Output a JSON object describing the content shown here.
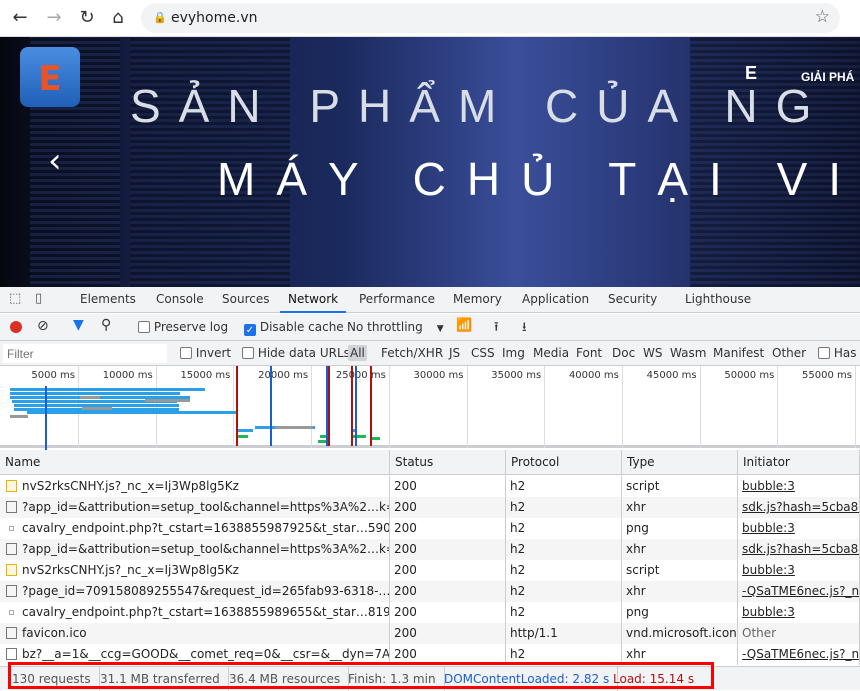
{
  "browser": {
    "url": "evyhome.vn",
    "icons": [
      "back-icon",
      "forward-icon",
      "reload-icon",
      "home-icon",
      "lock-icon",
      "star-icon"
    ]
  },
  "hero": {
    "logo_letter": "E",
    "headline1": "SẢN PHẨM CỦA NG",
    "headline2": "MÁY CHỦ TẠI VIỆ",
    "nav_text": "GIẢI PHÁ",
    "nav_logo": "E"
  },
  "devtools": {
    "tabs": [
      "Elements",
      "Console",
      "Sources",
      "Network",
      "Performance",
      "Memory",
      "Application",
      "Security",
      "Lighthouse"
    ],
    "active_tab": "Network",
    "toolbar": {
      "preserve_log": "Preserve log",
      "preserve_log_checked": false,
      "disable_cache": "Disable cache",
      "disable_cache_checked": true,
      "throttling": "No throttling"
    },
    "filter": {
      "placeholder": "Filter",
      "invert": "Invert",
      "hide_data_urls": "Hide data URLs",
      "types": [
        "All",
        "Fetch/XHR",
        "JS",
        "CSS",
        "Img",
        "Media",
        "Font",
        "Doc",
        "WS",
        "Wasm",
        "Manifest",
        "Other"
      ],
      "active_type": "All",
      "has_blocked": "Has b"
    },
    "timeline": {
      "ticks": [
        "5000 ms",
        "10000 ms",
        "15000 ms",
        "20000 ms",
        "25000 ms",
        "30000 ms",
        "35000 ms",
        "40000 ms",
        "45000 ms",
        "50000 ms",
        "55000 ms"
      ]
    },
    "columns": [
      "Name",
      "Status",
      "Protocol",
      "Type",
      "Initiator"
    ],
    "rows": [
      {
        "icon": "script",
        "name": "nvS2rksCNHY.js?_nc_x=Ij3Wp8lg5Kz",
        "status": "200",
        "protocol": "h2",
        "type": "script",
        "initiator": "bubble:3",
        "link": true
      },
      {
        "icon": "doc",
        "name": "?app_id=&attribution=setup_tool&channel=https%3A%2…k=jo…",
        "status": "200",
        "protocol": "h2",
        "type": "xhr",
        "initiator": "sdk.js?hash=5cba825.",
        "link": true
      },
      {
        "icon": "img",
        "name": "cavalry_endpoint.php?t_cstart=1638855987925&t_star…590&t…",
        "status": "200",
        "protocol": "h2",
        "type": "png",
        "initiator": "bubble:3",
        "link": true
      },
      {
        "icon": "doc",
        "name": "?app_id=&attribution=setup_tool&channel=https%3A%2…k=jo…",
        "status": "200",
        "protocol": "h2",
        "type": "xhr",
        "initiator": "sdk.js?hash=5cba825.",
        "link": true
      },
      {
        "icon": "script",
        "name": "nvS2rksCNHY.js?_nc_x=Ij3Wp8lg5Kz",
        "status": "200",
        "protocol": "h2",
        "type": "script",
        "initiator": "bubble:3",
        "link": true
      },
      {
        "icon": "doc",
        "name": "?page_id=709158089255547&request_id=265fab93-6318-…89…",
        "status": "200",
        "protocol": "h2",
        "type": "xhr",
        "initiator": "-QSaTME6nec.js?_nc_",
        "link": true
      },
      {
        "icon": "img",
        "name": "cavalry_endpoint.php?t_cstart=1638855989655&t_star…819&t…",
        "status": "200",
        "protocol": "h2",
        "type": "png",
        "initiator": "bubble:3",
        "link": true
      },
      {
        "icon": "doc",
        "name": "favicon.ico",
        "status": "200",
        "protocol": "http/1.1",
        "type": "vnd.microsoft.icon",
        "initiator": "Other",
        "link": false
      },
      {
        "icon": "doc",
        "name": "bz?__a=1&__ccg=GOOD&__comet_req=0&__csr=&__dyn=7Az……",
        "status": "200",
        "protocol": "h2",
        "type": "xhr",
        "initiator": "-QSaTME6nec.js?_nc_",
        "link": true
      }
    ],
    "status": {
      "requests": "130 requests",
      "transferred": "31.1 MB transferred",
      "resources": "36.4 MB resources",
      "finish": "Finish: 1.3 min",
      "dom": "DOMContentLoaded: 2.82 s",
      "load": "Load: 15.14 s"
    },
    "colors": {
      "accent": "#1a73e8",
      "dom_line": "#1a5fd0",
      "load_line": "#b01010",
      "highlight_box": "#ff0000"
    }
  }
}
